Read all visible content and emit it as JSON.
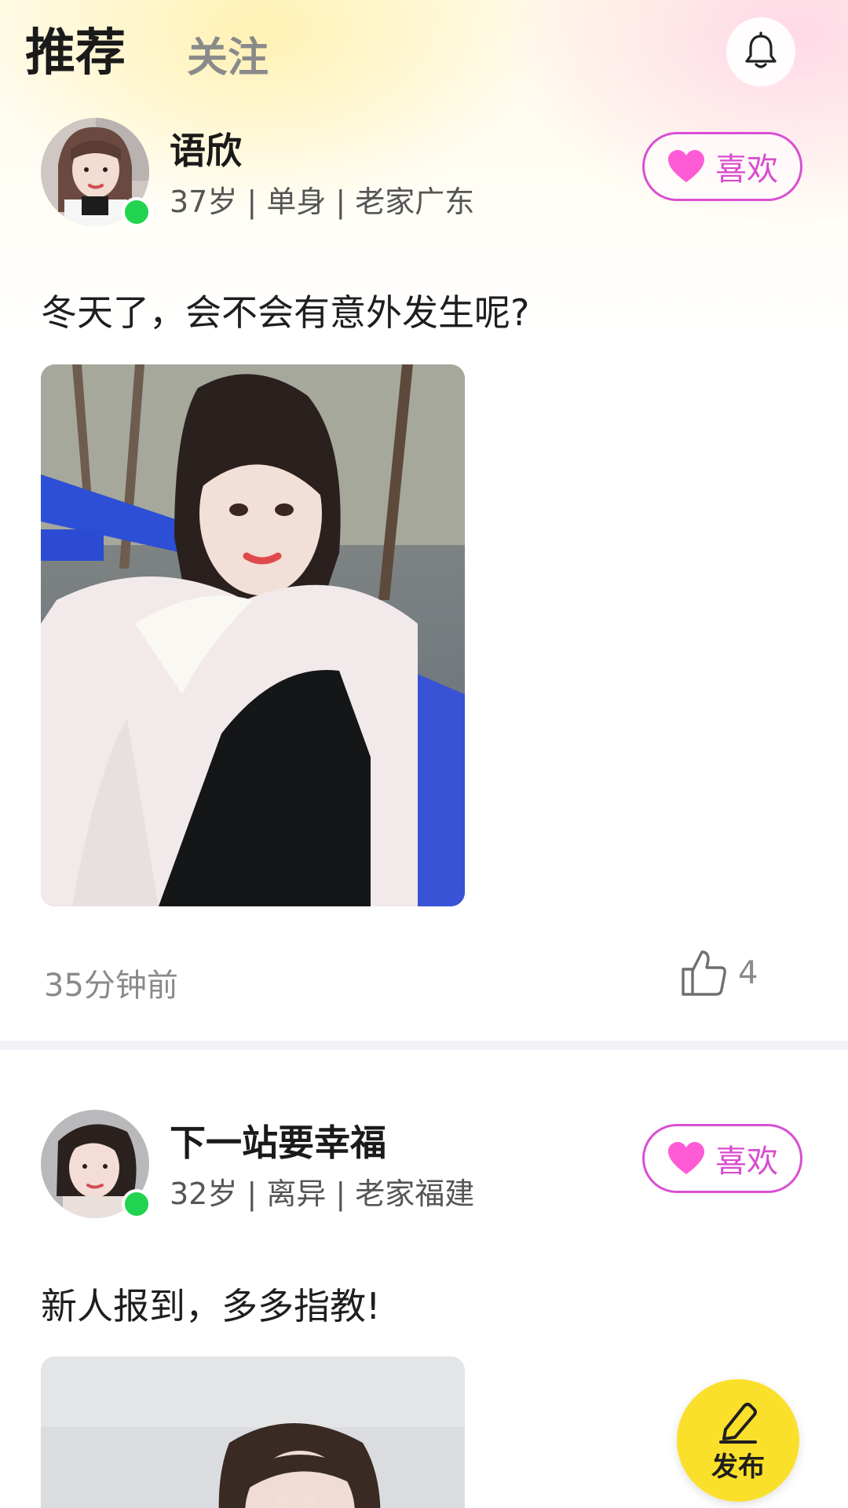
{
  "header": {
    "tab_recommend": "推荐",
    "tab_follow": "关注",
    "bell_icon": "bell-icon"
  },
  "posts": [
    {
      "name": "语欣",
      "meta": "37岁 | 单身 | 老家广东",
      "like_label": "喜欢",
      "text": "冬天了，会不会有意外发生呢?",
      "time": "35分钟前",
      "likes": "4",
      "online": true
    },
    {
      "name": "下一站要幸福",
      "meta": "32岁 | 离异 | 老家福建",
      "like_label": "喜欢",
      "text": "新人报到，多多指教!",
      "online": true
    }
  ],
  "publish": {
    "label": "发布",
    "icon": "edit-icon"
  },
  "colors": {
    "like_pink": "#d84dce",
    "online_green": "#22d34f",
    "publish_yellow": "#fbe02b"
  }
}
